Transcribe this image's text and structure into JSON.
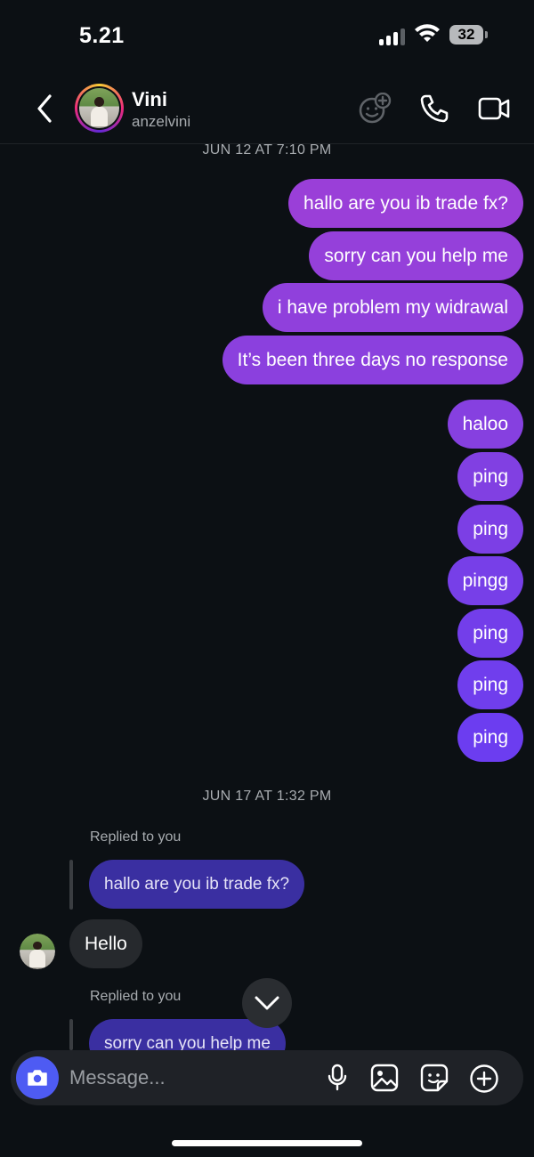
{
  "status_bar": {
    "time": "5.21",
    "battery": "32"
  },
  "header": {
    "back_icon": "chevron-left-icon",
    "contact_name": "Vini",
    "contact_handle": "anzelvini",
    "icons": [
      "add-sticker-icon",
      "phone-icon",
      "video-camera-icon"
    ]
  },
  "thread": {
    "date_1": "JUN 12 AT 7:10 PM",
    "outgoing_messages": [
      "hallo are you ib trade fx?",
      "sorry can you help me",
      "i have problem my widrawal",
      "It’s been three days no response",
      "haloo",
      "ping",
      "ping",
      "pingg",
      "ping",
      "ping",
      "ping"
    ],
    "date_2": "JUN 17 AT 1:32 PM",
    "reply_1": {
      "label": "Replied to you",
      "quoted": "hallo are you ib trade fx?",
      "message": "Hello"
    },
    "reply_2": {
      "label": "Replied to you",
      "quoted": "sorry can you help me"
    }
  },
  "composer": {
    "placeholder": "Message...",
    "icons": [
      "camera-icon",
      "microphone-icon",
      "gallery-icon",
      "sticker-icon",
      "plus-icon"
    ]
  },
  "colors": {
    "background": "#0c1014",
    "outgoing_top": "#9b3fd8",
    "outgoing_bottom": "#6d3cf0",
    "incoming": "#26292d",
    "reply_preview": "#3a2fa1",
    "camera_button": "#4e5bf3"
  }
}
